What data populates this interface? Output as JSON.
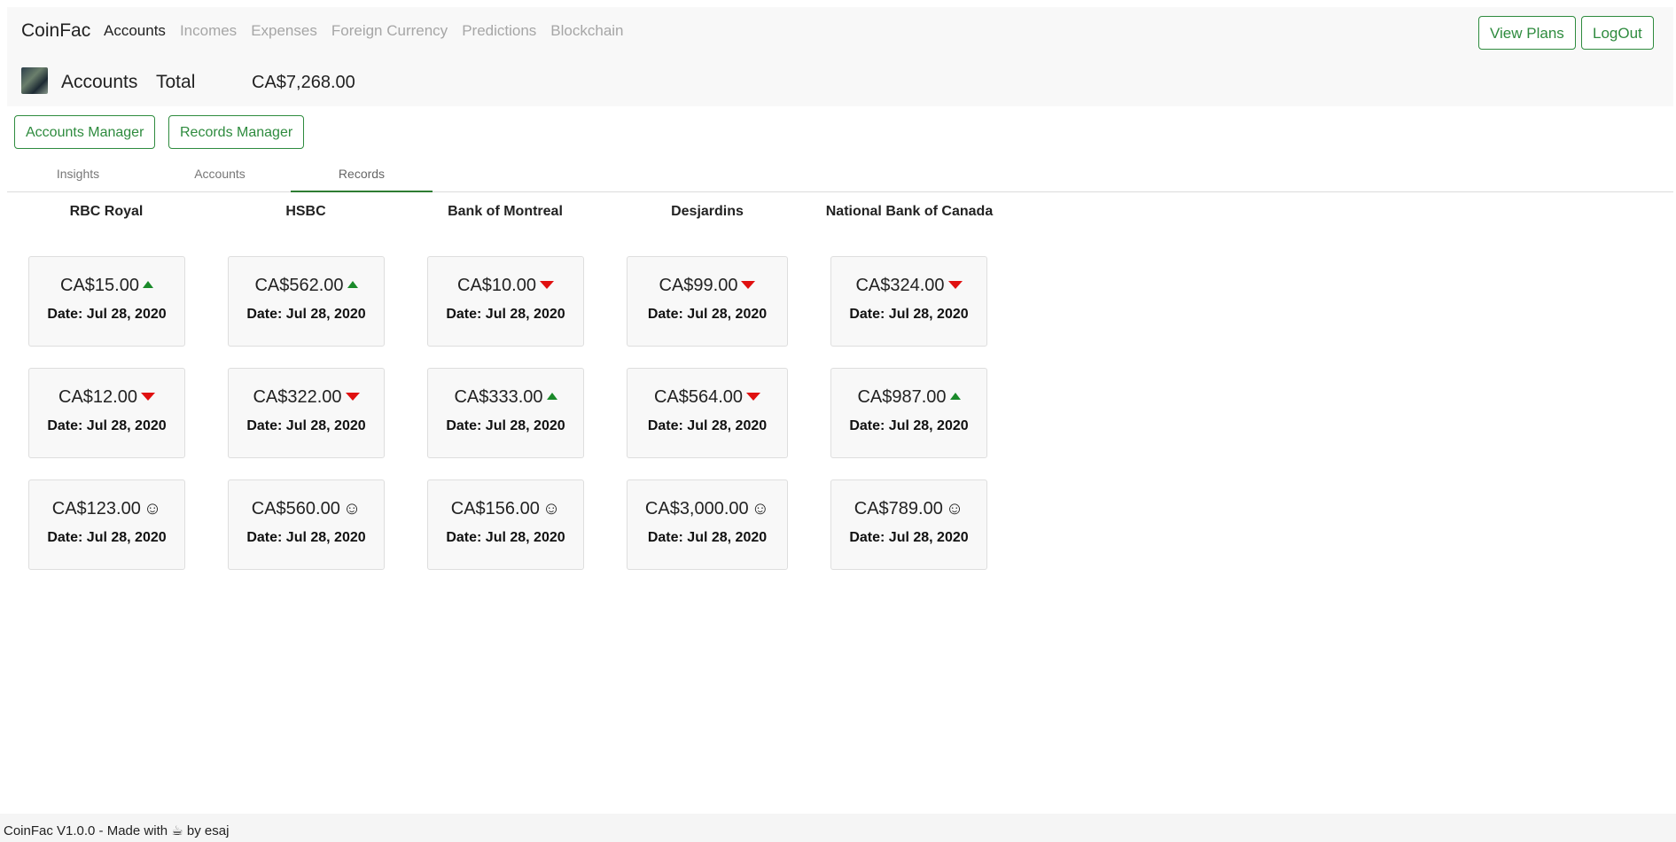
{
  "navbar": {
    "brand": "CoinFac",
    "items": [
      {
        "label": "Accounts",
        "active": true
      },
      {
        "label": "Incomes",
        "active": false
      },
      {
        "label": "Expenses",
        "active": false
      },
      {
        "label": "Foreign Currency",
        "active": false
      },
      {
        "label": "Predictions",
        "active": false
      },
      {
        "label": "Blockchain",
        "active": false
      }
    ],
    "view_plans": "View Plans",
    "logout": "LogOut"
  },
  "header": {
    "title": "Accounts",
    "total_label": "Total",
    "total_value": "CA$7,268.00"
  },
  "managers": {
    "accounts_manager": "Accounts Manager",
    "records_manager": "Records Manager"
  },
  "tabs": {
    "insights": "Insights",
    "accounts": "Accounts",
    "records": "Records",
    "active": "records"
  },
  "banks": [
    {
      "name": "RBC Royal",
      "records": [
        {
          "amount": "CA$15.00",
          "trend": "up",
          "date": "Date: Jul 28, 2020"
        },
        {
          "amount": "CA$12.00",
          "trend": "down",
          "date": "Date: Jul 28, 2020"
        },
        {
          "amount": "CA$123.00",
          "trend": "smile",
          "date": "Date: Jul 28, 2020"
        }
      ]
    },
    {
      "name": "HSBC",
      "records": [
        {
          "amount": "CA$562.00",
          "trend": "up",
          "date": "Date: Jul 28, 2020"
        },
        {
          "amount": "CA$322.00",
          "trend": "down",
          "date": "Date: Jul 28, 2020"
        },
        {
          "amount": "CA$560.00",
          "trend": "smile",
          "date": "Date: Jul 28, 2020"
        }
      ]
    },
    {
      "name": "Bank of Montreal",
      "records": [
        {
          "amount": "CA$10.00",
          "trend": "down",
          "date": "Date: Jul 28, 2020"
        },
        {
          "amount": "CA$333.00",
          "trend": "up",
          "date": "Date: Jul 28, 2020"
        },
        {
          "amount": "CA$156.00",
          "trend": "smile",
          "date": "Date: Jul 28, 2020"
        }
      ]
    },
    {
      "name": "Desjardins",
      "records": [
        {
          "amount": "CA$99.00",
          "trend": "down",
          "date": "Date: Jul 28, 2020"
        },
        {
          "amount": "CA$564.00",
          "trend": "down",
          "date": "Date: Jul 28, 2020"
        },
        {
          "amount": "CA$3,000.00",
          "trend": "smile",
          "date": "Date: Jul 28, 2020"
        }
      ]
    },
    {
      "name": "National Bank of Canada",
      "records": [
        {
          "amount": "CA$324.00",
          "trend": "down",
          "date": "Date: Jul 28, 2020"
        },
        {
          "amount": "CA$987.00",
          "trend": "up",
          "date": "Date: Jul 28, 2020"
        },
        {
          "amount": "CA$789.00",
          "trend": "smile",
          "date": "Date: Jul 28, 2020"
        }
      ]
    }
  ],
  "icons": {
    "up": "triangle-up-icon",
    "down": "triangle-down-icon",
    "smile": "smiley-icon",
    "coffee": "coffee-icon"
  },
  "colors": {
    "accent": "#2e8b3e",
    "up": "#1a8a2a",
    "down": "#e01010"
  },
  "footer": {
    "prefix": "CoinFac V1.0.0 - Made with",
    "suffix": "by esaj"
  }
}
